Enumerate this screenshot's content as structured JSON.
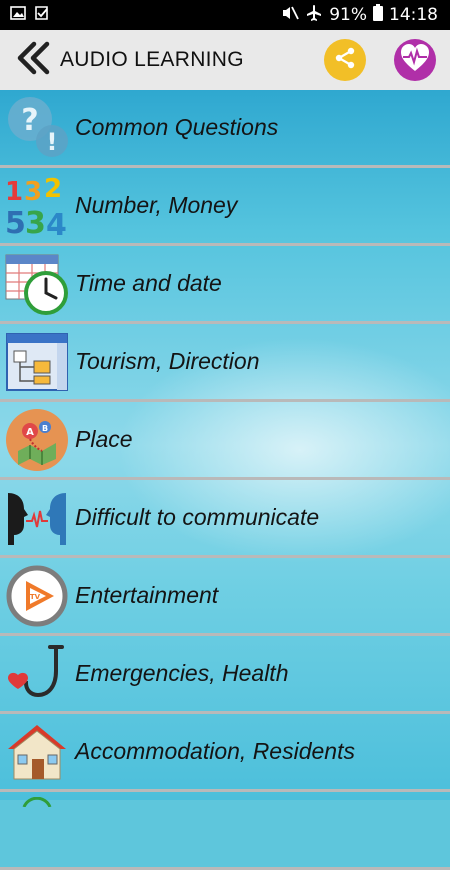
{
  "status_bar": {
    "battery": "91%",
    "time": "14:18"
  },
  "app_bar": {
    "title": "AUDIO LEARNING"
  },
  "categories": [
    {
      "label": "Common Questions",
      "icon": "question-bubbles-icon"
    },
    {
      "label": "Number, Money",
      "icon": "numbers-icon"
    },
    {
      "label": "Time and date",
      "icon": "calendar-clock-icon"
    },
    {
      "label": "Tourism, Direction",
      "icon": "direction-window-icon"
    },
    {
      "label": "Place",
      "icon": "map-pin-icon"
    },
    {
      "label": "Difficult to communicate",
      "icon": "speaking-heads-icon"
    },
    {
      "label": "Entertainment",
      "icon": "tv-play-icon"
    },
    {
      "label": "Emergencies, Health",
      "icon": "stethoscope-icon"
    },
    {
      "label": "Accommodation, Residents",
      "icon": "house-icon"
    }
  ],
  "colors": {
    "share": "#f2bf27",
    "favorite": "#b02fa8",
    "app_bar": "#e9e9e9"
  }
}
